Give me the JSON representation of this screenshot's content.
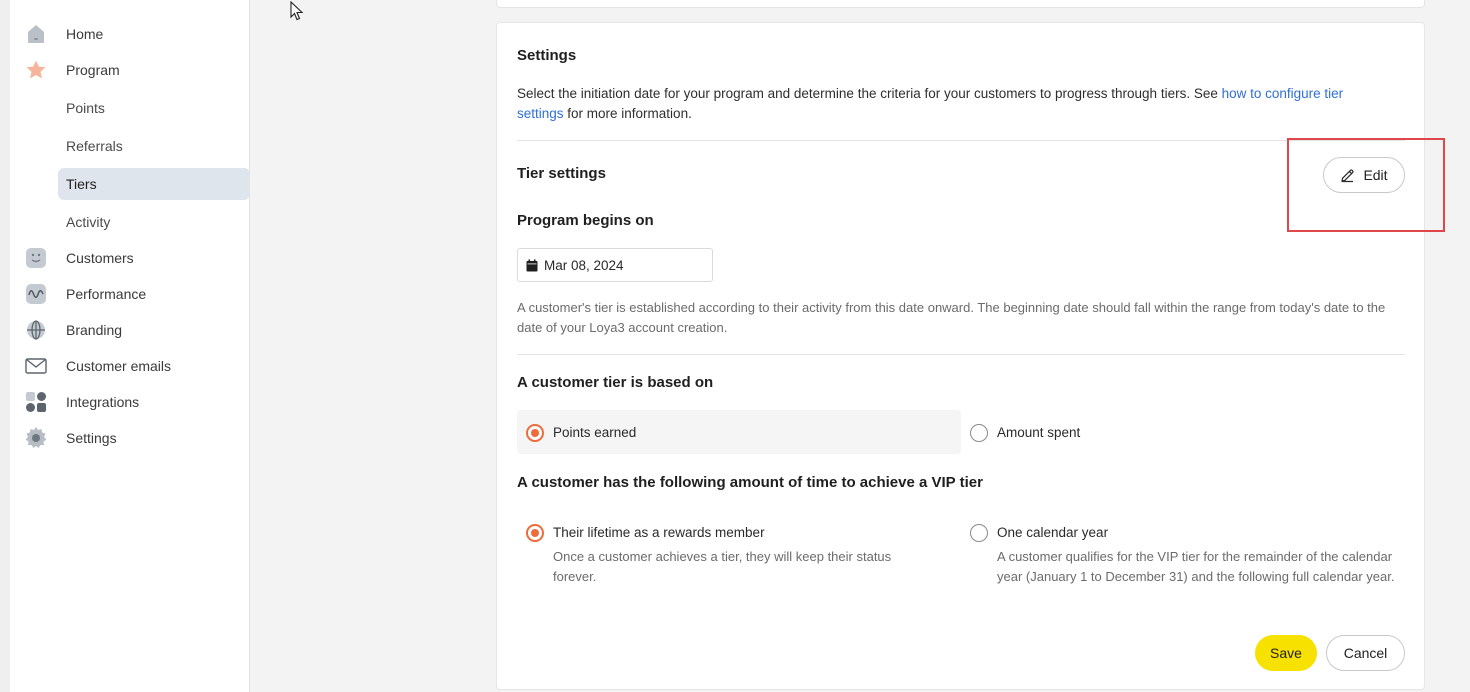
{
  "sidebar": {
    "items": [
      {
        "label": "Home",
        "icon": "home-icon"
      },
      {
        "label": "Program",
        "icon": "star-icon"
      },
      {
        "label": "Customers",
        "icon": "smiley-icon"
      },
      {
        "label": "Performance",
        "icon": "wave-icon"
      },
      {
        "label": "Branding",
        "icon": "globe-icon"
      },
      {
        "label": "Customer emails",
        "icon": "envelope-icon"
      },
      {
        "label": "Integrations",
        "icon": "grid-icon"
      },
      {
        "label": "Settings",
        "icon": "gear-icon"
      }
    ],
    "program_subitems": [
      "Points",
      "Referrals",
      "Tiers",
      "Activity"
    ],
    "active_subitem": "Tiers"
  },
  "settings": {
    "title": "Settings",
    "description_before_link": "Select the initiation date for your program and determine the criteria for your customers to progress through tiers. See ",
    "link_text": "how to configure tier settings",
    "description_after_link": " for more information.",
    "tier_settings_title": "Tier settings",
    "edit_label": "Edit",
    "program_begins_title": "Program begins on",
    "program_begins_date": "Mar 08, 2024",
    "program_begins_help": "A customer's tier is established according to their activity from this date onward. The beginning date should fall within the range from today's date to the date of your Loya3 account creation.",
    "based_on_title": "A customer tier is based on",
    "based_on_options": [
      {
        "label": "Points earned",
        "selected": true
      },
      {
        "label": "Amount spent",
        "selected": false
      }
    ],
    "time_title": "A customer has the following amount of time to achieve a VIP tier",
    "time_options": [
      {
        "label": "Their lifetime as a rewards member",
        "description": "Once a customer achieves a tier, they will keep their status forever.",
        "selected": true
      },
      {
        "label": "One calendar year",
        "description": "A customer qualifies for the VIP tier for the remainder of the calendar year (January 1 to December 31) and the following full calendar year.",
        "selected": false
      }
    ],
    "save_label": "Save",
    "cancel_label": "Cancel"
  },
  "colors": {
    "accent": "#ee6b3b",
    "save_button": "#f6e100",
    "link": "#2f6fd6",
    "highlight": "#e0474c"
  }
}
